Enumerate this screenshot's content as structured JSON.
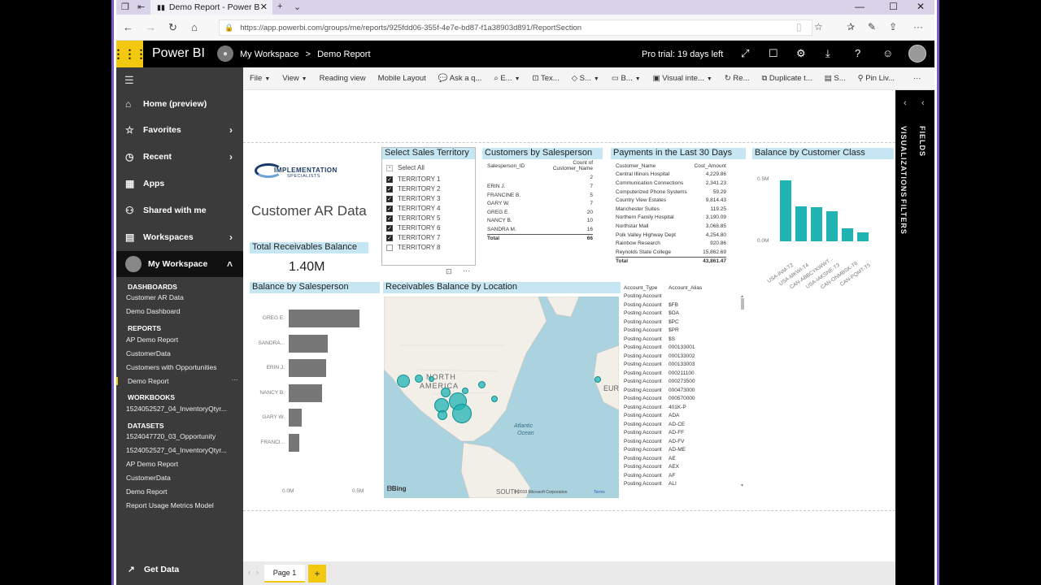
{
  "browser": {
    "tab_title": "Demo Report - Power B",
    "url": "https://app.powerbi.com/groups/me/reports/925fdd06-355f-4e7e-bd87-f1a38903d891/ReportSection"
  },
  "header": {
    "brand": "Power BI",
    "breadcrumb_workspace": "My Workspace",
    "breadcrumb_sep": ">",
    "breadcrumb_report": "Demo Report",
    "trial": "Pro trial: 19 days left"
  },
  "nav": {
    "home": "Home (preview)",
    "favorites": "Favorites",
    "recent": "Recent",
    "apps": "Apps",
    "shared": "Shared with me",
    "workspaces": "Workspaces",
    "myworkspace": "My Workspace",
    "dashboards_title": "DASHBOARDS",
    "dashboards": [
      "Customer AR Data",
      "Demo Dashboard"
    ],
    "reports_title": "REPORTS",
    "reports": [
      "AP Demo Report",
      "CustomerData",
      "Customers with Opportunities",
      "Demo Report"
    ],
    "workbooks_title": "WORKBOOKS",
    "workbooks": [
      "1524052527_04_InventoryQtyr..."
    ],
    "datasets_title": "DATASETS",
    "datasets": [
      "1524047720_03_Opportunity",
      "1524052527_04_InventoryQtyr...",
      "AP Demo Report",
      "CustomerData",
      "Demo Report",
      "Report Usage Metrics Model"
    ],
    "get_data": "Get Data"
  },
  "toolbar": [
    "File",
    "View",
    "Reading view",
    "Mobile Layout",
    "Ask a q...",
    "E...",
    "Tex...",
    "S...",
    "B...",
    "Visual inte...",
    "Re...",
    "Duplicate t...",
    "S...",
    "Pin Liv..."
  ],
  "report": {
    "logo_line1": "IMPLEMENTATION",
    "logo_line2": "SPECIALISTS",
    "title": "Customer AR Data",
    "kpi_title": "Total Receivables Balance",
    "kpi_value": "1.40M",
    "slicer": {
      "title": "Select Sales Territory",
      "select_all": "Select All",
      "items": [
        "TERRITORY 1",
        "TERRITORY 2",
        "TERRITORY 3",
        "TERRITORY 4",
        "TERRITORY 5",
        "TERRITORY 6",
        "TERRITORY 7",
        "TERRITORY 8"
      ],
      "checked": [
        true,
        true,
        true,
        true,
        true,
        true,
        true,
        false
      ]
    },
    "cust_by_sp": {
      "title": "Customers by Salesperson",
      "col1": "Salesperson_ID",
      "col2": "Count of Customer_Name",
      "rows": [
        [
          "",
          "2"
        ],
        [
          "ERIN J.",
          "7"
        ],
        [
          "FRANCINE B.",
          "5"
        ],
        [
          "GARY W.",
          "7"
        ],
        [
          "GREG E.",
          "20"
        ],
        [
          "NANCY B.",
          "10"
        ],
        [
          "SANDRA M.",
          "16"
        ]
      ],
      "total_label": "Total",
      "total_value": "66"
    },
    "payments": {
      "title": "Payments in the Last 30 Days",
      "col1": "Customer_Name",
      "col2": "Cost_Amount",
      "rows": [
        [
          "Central Illinois Hospital",
          "4,229.86"
        ],
        [
          "Communication Connections",
          "2,341.23"
        ],
        [
          "Computerized Phone Systems",
          "59.29"
        ],
        [
          "Country View Estates",
          "9,814.43"
        ],
        [
          "Manchester Suites",
          "119.25"
        ],
        [
          "Northern Family Hospital",
          "3,190.09"
        ],
        [
          "Northstar Mall",
          "3,068.85"
        ],
        [
          "Polk Valley Highway Dept",
          "4,254.80"
        ],
        [
          "Rainbow Research",
          "920.86"
        ],
        [
          "Reynolds State College",
          "15,862.69"
        ]
      ],
      "total_label": "Total",
      "total_value": "43,861.47"
    },
    "bal_class": {
      "title": "Balance by Customer Class",
      "y_top": "0.5M",
      "y_bottom": "0.0M",
      "labels": [
        "USA-INM-T2",
        "USA-MKWI-T4",
        "CAN-ABBCYKWWT...",
        "USA-IAKSNE-T3",
        "CAN-ONMBSK-T6",
        "CAN-PQMT-T5"
      ]
    },
    "bal_sp": {
      "title": "Balance by Salesperson",
      "labels": [
        "GREG E.",
        "SANDRA...",
        "ERIN J.",
        "NANCY B.",
        "GARY W.",
        "FRANCI..."
      ],
      "x_left": "0.0M",
      "x_right": "0.5M"
    },
    "map": {
      "title": "Receivables Balance by Location",
      "label_na1": "NORTH",
      "label_na2": "AMERICA",
      "label_eu": "EUR",
      "label_ocean1": "Atlantic",
      "label_ocean2": "Ocean",
      "label_sa": "SOUTH",
      "bing": "Bing",
      "copyright": "© 2019 Microsoft Corporation",
      "terms": "Terms"
    },
    "accounts": {
      "col1": "Account_Type",
      "col2": "Account_Alias",
      "rows": [
        [
          "Posting Account",
          ""
        ],
        [
          "Posting Account",
          "$FB"
        ],
        [
          "Posting Account",
          "$OA"
        ],
        [
          "Posting Account",
          "$PC"
        ],
        [
          "Posting Account",
          "$PR"
        ],
        [
          "Posting Account",
          "$S"
        ],
        [
          "Posting Account",
          "000133001"
        ],
        [
          "Posting Account",
          "000133002"
        ],
        [
          "Posting Account",
          "000133003"
        ],
        [
          "Posting Account",
          "000211100"
        ],
        [
          "Posting Account",
          "000273500"
        ],
        [
          "Posting Account",
          "000473000"
        ],
        [
          "Posting Account",
          "000570000"
        ],
        [
          "Posting Account",
          "401K-P"
        ],
        [
          "Posting Account",
          "ADA"
        ],
        [
          "Posting Account",
          "AD-CE"
        ],
        [
          "Posting Account",
          "AD-FF"
        ],
        [
          "Posting Account",
          "AD-FV"
        ],
        [
          "Posting Account",
          "AD-ME"
        ],
        [
          "Posting Account",
          "AE"
        ],
        [
          "Posting Account",
          "AEX"
        ],
        [
          "Posting Account",
          "AF"
        ],
        [
          "Posting Account",
          "ALI"
        ]
      ]
    }
  },
  "right_panel": {
    "fields": "FIELDS",
    "visualizations": "VISUALIZATIONS",
    "filters": "FILTERS"
  },
  "pages": {
    "page1": "Page 1",
    "add": "+"
  },
  "chart_data": [
    {
      "type": "bar",
      "title": "Balance by Customer Class",
      "categories": [
        "USA-INM-T2",
        "USA-MKWI-T4",
        "CAN-ABBCYKWWT...",
        "USA-IAKSNE-T3",
        "CAN-ONMBSK-T6",
        "CAN-PQMT-T5"
      ],
      "values": [
        0.47,
        0.27,
        0.26,
        0.23,
        0.1,
        0.07
      ],
      "ylim": [
        0,
        0.5
      ],
      "color": "#1fb3b3"
    },
    {
      "type": "bar",
      "orientation": "horizontal",
      "title": "Balance by Salesperson",
      "categories": [
        "GREG E.",
        "SANDRA...",
        "ERIN J.",
        "NANCY B.",
        "GARY W.",
        "FRANCI..."
      ],
      "values": [
        0.4,
        0.22,
        0.21,
        0.19,
        0.075,
        0.06
      ],
      "xlim": [
        0,
        0.5
      ],
      "color": "#777777"
    }
  ]
}
